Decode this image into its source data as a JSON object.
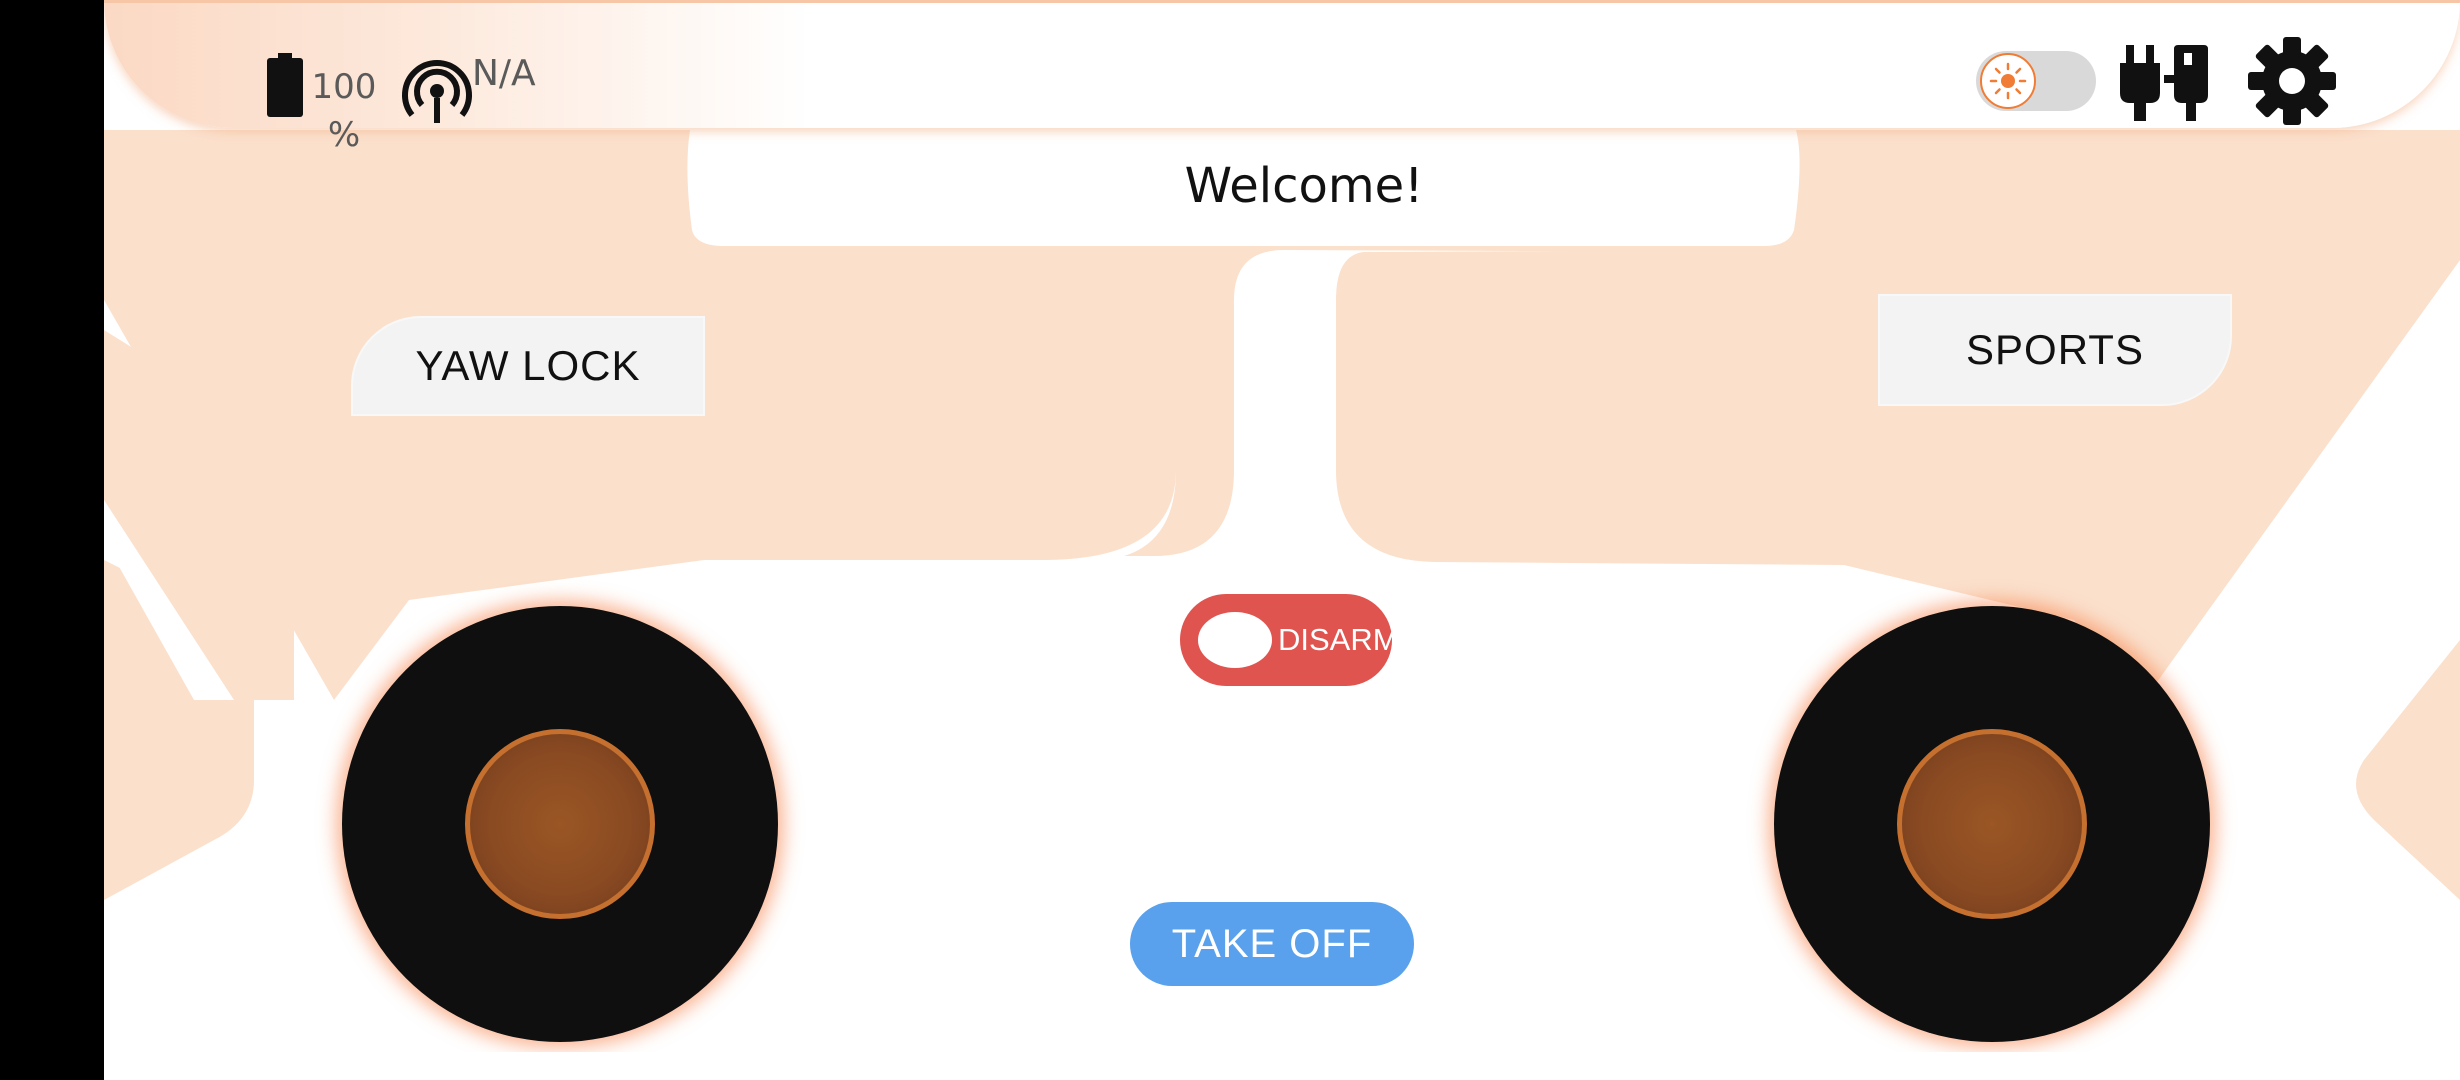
{
  "status_bar": {
    "battery_icon": "battery-full-icon",
    "battery_percent": "100\n%",
    "signal_icon": "antenna-signal-icon",
    "link_status": "N/A",
    "theme_toggle_icon": "sun-icon",
    "connection_icon": "usb-plug-icon",
    "settings_icon": "gear-icon"
  },
  "welcome": {
    "text": "Welcome!"
  },
  "controls": {
    "yaw_lock_label": "YAW LOCK",
    "sports_label": "SPORTS",
    "disarm_label": "DISARM",
    "takeoff_label": "TAKE OFF"
  },
  "colors": {
    "accent_orange": "#f07c35",
    "disarm_red": "#e05450",
    "takeoff_blue": "#59a1ec",
    "decor_peach": "#fbe0cc"
  }
}
